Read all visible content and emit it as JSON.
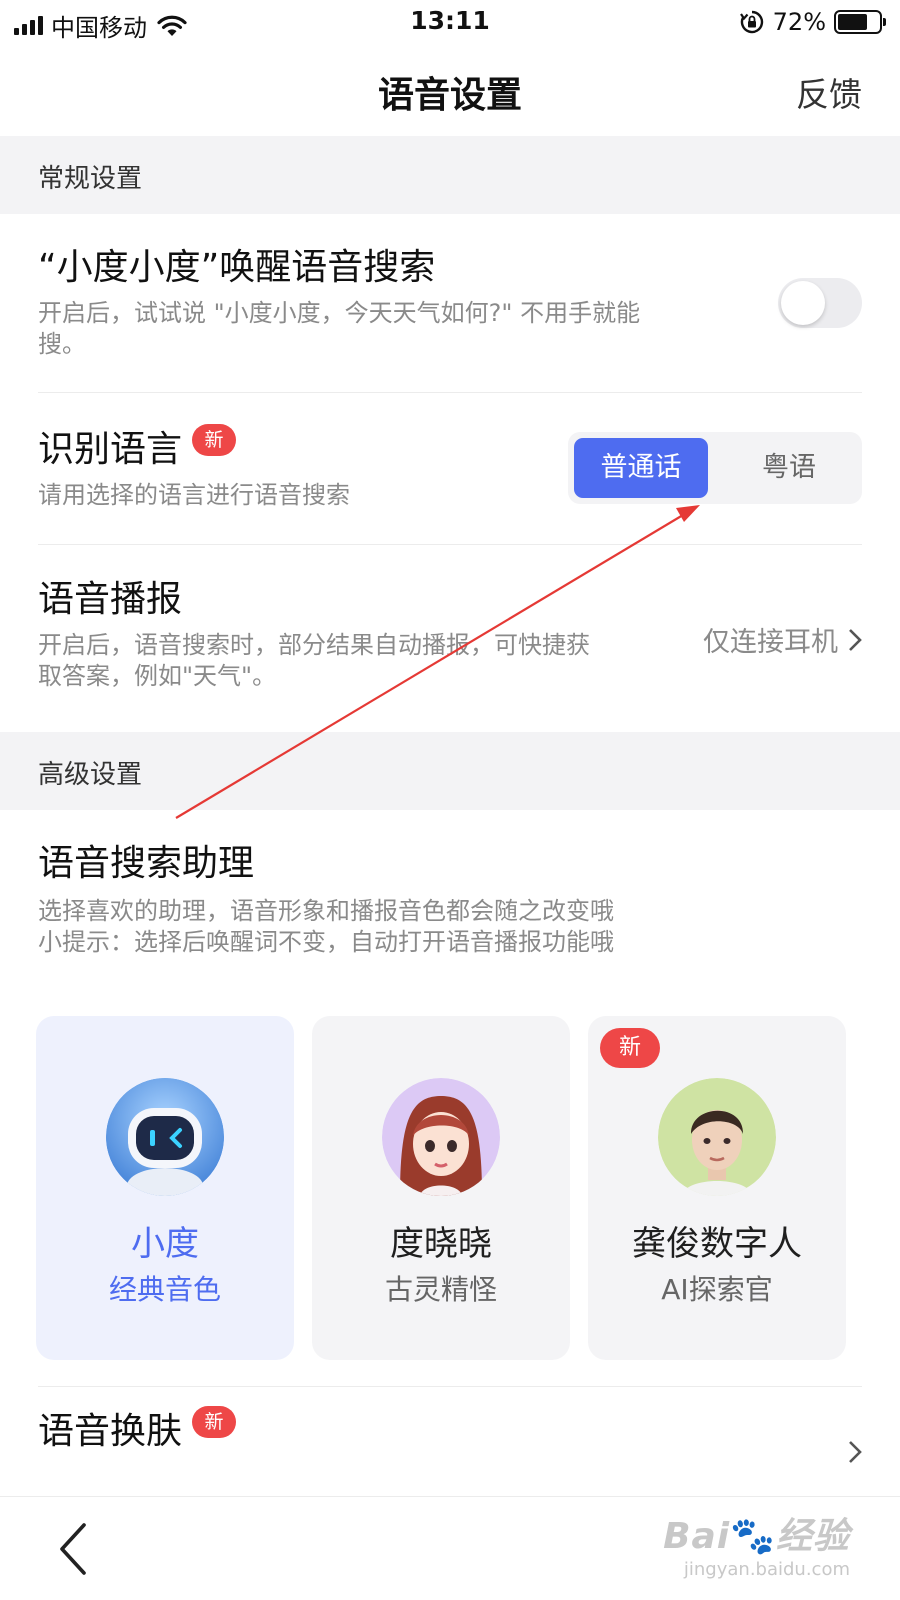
{
  "status_bar": {
    "carrier": "中国移动",
    "time": "13:11",
    "battery_percent": "72%",
    "battery_level": 0.72
  },
  "nav": {
    "title": "语音设置",
    "feedback_label": "反馈"
  },
  "sections": {
    "general": "常规设置",
    "advanced": "高级设置"
  },
  "wake_search": {
    "title": "“小度小度”唤醒语音搜索",
    "description": "开启后，试试说 \"小度小度，今天天气如何?\" 不用手就能搜。",
    "enabled": false
  },
  "language": {
    "title": "识别语言",
    "badge": "新",
    "description": "请用选择的语言进行语音搜索",
    "options": [
      "普通话",
      "粤语"
    ],
    "selected": "普通话"
  },
  "broadcast": {
    "title": "语音播报",
    "description": "开启后，语音搜索时，部分结果自动播报，可快捷获取答案，例如\"天气\"。",
    "value": "仅连接耳机"
  },
  "assistant": {
    "title": "语音搜索助理",
    "description_line1": "选择喜欢的助理，语音形象和播报音色都会随之改变哦",
    "description_line2": "小提示：选择后唤醒词不变，自动打开语音播报功能哦",
    "cards": [
      {
        "name": "小度",
        "subtitle": "经典音色",
        "selected": true
      },
      {
        "name": "度晓晓",
        "subtitle": "古灵精怪",
        "selected": false
      },
      {
        "name": "龚俊数字人",
        "subtitle": "AI探索官",
        "selected": false,
        "badge": "新"
      }
    ]
  },
  "skin": {
    "title": "语音换肤",
    "badge": "新"
  },
  "colors": {
    "accent": "#4e6cf0",
    "badge_red": "#ee4747",
    "annotation_arrow": "#e53935"
  }
}
